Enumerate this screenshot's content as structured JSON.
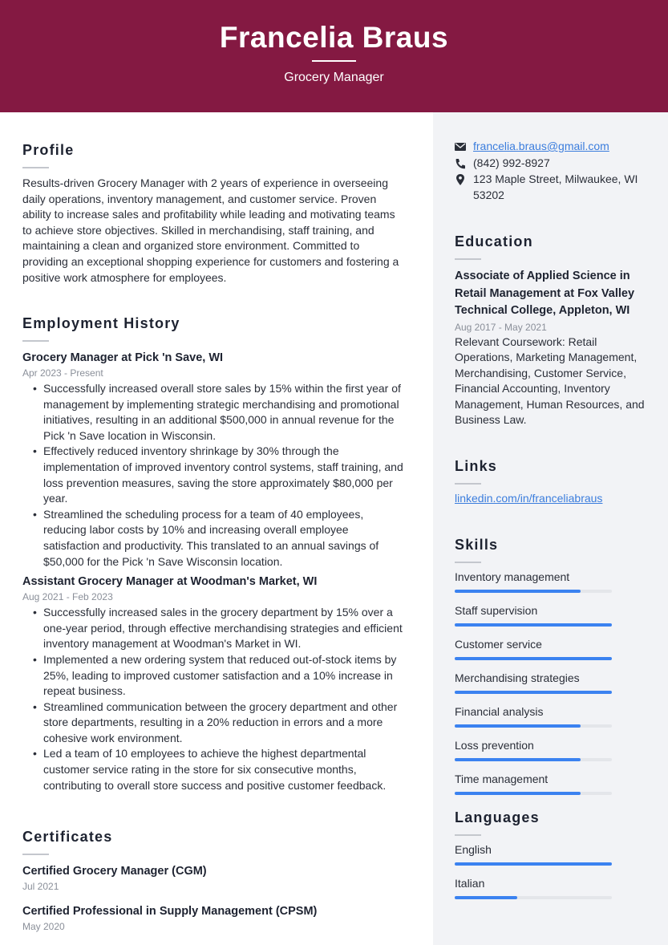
{
  "header": {
    "name": "Francelia Braus",
    "job_title": "Grocery Manager",
    "background_color": "#841942"
  },
  "profile": {
    "heading": "Profile",
    "text": "Results-driven Grocery Manager with 2 years of experience in overseeing daily operations, inventory management, and customer service. Proven ability to increase sales and profitability while leading and motivating teams to achieve store objectives. Skilled in merchandising, staff training, and maintaining a clean and organized store environment. Committed to providing an exceptional shopping experience for customers and fostering a positive work atmosphere for employees."
  },
  "employment": {
    "heading": "Employment History",
    "jobs": [
      {
        "title": "Grocery Manager at Pick 'n Save, WI",
        "dates": "Apr 2023 - Present",
        "bullets": [
          "Successfully increased overall store sales by 15% within the first year of management by implementing strategic merchandising and promotional initiatives, resulting in an additional $500,000 in annual revenue for the Pick 'n Save location in Wisconsin.",
          "Effectively reduced inventory shrinkage by 30% through the implementation of improved inventory control systems, staff training, and loss prevention measures, saving the store approximately $80,000 per year.",
          "Streamlined the scheduling process for a team of 40 employees, reducing labor costs by 10% and increasing overall employee satisfaction and productivity. This translated to an annual savings of $50,000 for the Pick 'n Save Wisconsin location."
        ]
      },
      {
        "title": "Assistant Grocery Manager at Woodman's Market, WI",
        "dates": "Aug 2021 - Feb 2023",
        "bullets": [
          "Successfully increased sales in the grocery department by 15% over a one-year period, through effective merchandising strategies and efficient inventory management at Woodman's Market in WI.",
          "Implemented a new ordering system that reduced out-of-stock items by 25%, leading to improved customer satisfaction and a 10% increase in repeat business.",
          "Streamlined communication between the grocery department and other store departments, resulting in a 20% reduction in errors and a more cohesive work environment.",
          "Led a team of 10 employees to achieve the highest departmental customer service rating in the store for six consecutive months, contributing to overall store success and positive customer feedback."
        ]
      }
    ]
  },
  "certificates": {
    "heading": "Certificates",
    "items": [
      {
        "name": "Certified Grocery Manager (CGM)",
        "date": "Jul 2021"
      },
      {
        "name": "Certified Professional in Supply Management (CPSM)",
        "date": "May 2020"
      }
    ]
  },
  "contact": {
    "email": "francelia.braus@gmail.com",
    "phone": "(842) 992-8927",
    "address": "123 Maple Street, Milwaukee, WI 53202",
    "icons": [
      "envelope-icon",
      "phone-icon",
      "map-pin-icon"
    ]
  },
  "education": {
    "heading": "Education",
    "degree": "Associate of Applied Science in Retail Management at Fox Valley Technical College, Appleton, WI",
    "dates": "Aug 2017 - May 2021",
    "description": "Relevant Coursework: Retail Operations, Marketing Management, Merchandising, Customer Service, Financial Accounting, Inventory Management, Human Resources, and Business Law."
  },
  "links": {
    "heading": "Links",
    "items": [
      "linkedin.com/in/franceliabraus"
    ]
  },
  "skills": {
    "heading": "Skills",
    "accent_color": "#3b82f0",
    "items": [
      {
        "label": "Inventory management",
        "level": 0.8
      },
      {
        "label": "Staff supervision",
        "level": 1.0
      },
      {
        "label": "Customer service",
        "level": 1.0
      },
      {
        "label": "Merchandising strategies",
        "level": 1.0
      },
      {
        "label": "Financial analysis",
        "level": 0.8
      },
      {
        "label": "Loss prevention",
        "level": 0.8
      },
      {
        "label": "Time management",
        "level": 0.8
      }
    ]
  },
  "languages": {
    "heading": "Languages",
    "items": [
      {
        "label": "English",
        "level": 1.0
      },
      {
        "label": "Italian",
        "level": 0.4
      }
    ]
  }
}
